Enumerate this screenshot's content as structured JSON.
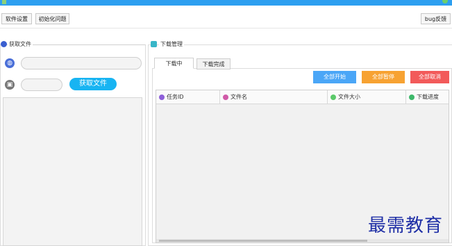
{
  "window": {
    "title": ""
  },
  "toolbar": {
    "settings_label": "软件设置",
    "init_label": "初始化问题",
    "bug_label": "bug反馈"
  },
  "fetch_group": {
    "title": "获取文件",
    "url_input": {
      "value": "",
      "placeholder": ""
    },
    "password_input": {
      "value": "",
      "placeholder": ""
    },
    "fetch_button": "获取文件"
  },
  "download_group": {
    "title": "下载管理",
    "tabs": [
      {
        "label": "下载中",
        "active": true
      },
      {
        "label": "下载完成",
        "active": false
      }
    ],
    "actions": [
      {
        "label": "全部开始",
        "color": "#4aa6f7"
      },
      {
        "label": "全部暂停",
        "color": "#f7a232"
      },
      {
        "label": "全部取消",
        "color": "#f25a5a"
      }
    ],
    "columns": [
      {
        "label": "任务ID",
        "icon": "task-id-icon",
        "color": "#8e5fd9"
      },
      {
        "label": "文件名",
        "icon": "file-name-icon",
        "color": "#d05aa8"
      },
      {
        "label": "文件大小",
        "icon": "file-size-icon",
        "color": "#5bc96a"
      },
      {
        "label": "下载进度",
        "icon": "progress-icon",
        "color": "#3db86a"
      }
    ]
  },
  "watermark": "最需教育"
}
